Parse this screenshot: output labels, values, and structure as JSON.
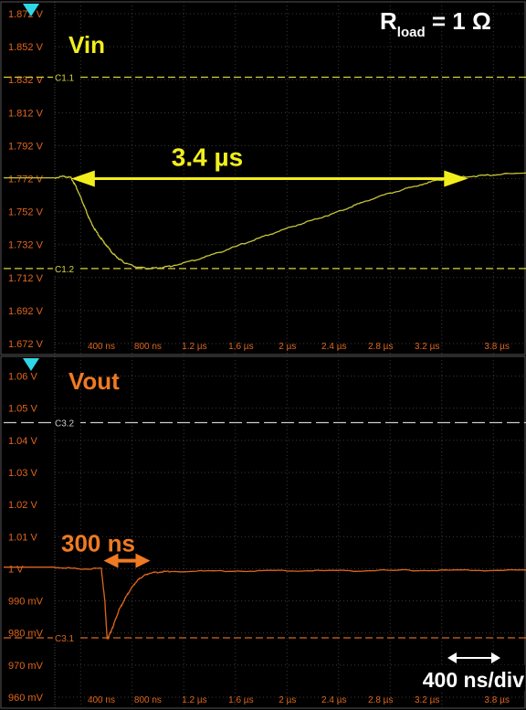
{
  "chart_data": [
    {
      "type": "line",
      "title": "Vin",
      "title_color": "#f2ee1c",
      "trace_color": "#c8c63a",
      "annotation_top_right": {
        "main": "R",
        "sub": "load",
        "rest": " = 1 Ω",
        "color": "#ffffff"
      },
      "ytick_labels": [
        "1.872 V",
        "1.852 V",
        "1.832 V",
        "1.812 V",
        "1.792 V",
        "1.772 V",
        "1.752 V",
        "1.732 V",
        "1.712 V",
        "1.692 V",
        "1.672 V"
      ],
      "ytick_values": [
        1.872,
        1.852,
        1.832,
        1.812,
        1.792,
        1.772,
        1.752,
        1.732,
        1.712,
        1.692,
        1.672
      ],
      "ylim": [
        1.672,
        1.877
      ],
      "xtick_labels": [
        "400 ns",
        "800 ns",
        "1.2 µs",
        "1.6 µs",
        "2 µs",
        "2.4 µs",
        "2.8 µs",
        "3.2 µs",
        "3.8 µs"
      ],
      "xtick_values": [
        0.4,
        0.8,
        1.2,
        1.6,
        2.0,
        2.4,
        2.8,
        3.2,
        3.8
      ],
      "xlim": [
        0,
        4.05
      ],
      "x_unit": "µs",
      "cursors": [
        {
          "label": "C1.1",
          "value": 1.8335,
          "color": "#d8d23a"
        },
        {
          "label": "C1.2",
          "value": 1.7175,
          "color": "#d8d23a"
        }
      ],
      "measurement": {
        "label": "3.4 µs",
        "x_start": 0.14,
        "x_end": 3.55,
        "y": 1.772,
        "color": "#f2ee1c"
      },
      "x": [
        0.0,
        0.08,
        0.14,
        0.18,
        0.22,
        0.26,
        0.3,
        0.35,
        0.4,
        0.45,
        0.5,
        0.55,
        0.6,
        0.7,
        0.8,
        0.9,
        1.0,
        1.2,
        1.4,
        1.6,
        1.8,
        2.0,
        2.2,
        2.4,
        2.6,
        2.8,
        3.0,
        3.2,
        3.4,
        3.6,
        3.8,
        4.05
      ],
      "y": [
        1.7725,
        1.7735,
        1.7725,
        1.7675,
        1.761,
        1.754,
        1.747,
        1.7405,
        1.7355,
        1.731,
        1.7265,
        1.7235,
        1.721,
        1.7185,
        1.7175,
        1.718,
        1.719,
        1.7225,
        1.727,
        1.732,
        1.737,
        1.742,
        1.7465,
        1.751,
        1.7565,
        1.7615,
        1.7655,
        1.7695,
        1.7725,
        1.7735,
        1.7745,
        1.7755
      ]
    },
    {
      "type": "line",
      "title": "Vout",
      "title_color": "#f07a22",
      "trace_color": "#e0661c",
      "ytick_labels": [
        "1.06 V",
        "1.05 V",
        "1.04 V",
        "1.03 V",
        "1.02 V",
        "1.01 V",
        "1 V",
        "990 mV",
        "980 mV",
        "970 mV",
        "960 mV"
      ],
      "ytick_values": [
        1.06,
        1.05,
        1.04,
        1.03,
        1.02,
        1.01,
        1.0,
        0.99,
        0.98,
        0.97,
        0.96
      ],
      "ylim": [
        0.96,
        1.065
      ],
      "xtick_labels": [
        "400 ns",
        "800 ns",
        "1.2 µs",
        "1.6 µs",
        "2 µs",
        "2.4 µs",
        "2.8 µs",
        "3.2 µs",
        "3.8 µs"
      ],
      "xtick_values": [
        0.4,
        0.8,
        1.2,
        1.6,
        2.0,
        2.4,
        2.8,
        3.2,
        3.8
      ],
      "xlim": [
        0,
        4.05
      ],
      "x_unit": "µs",
      "cursors": [
        {
          "label": "C3.2",
          "value": 1.0455,
          "color": "#cccccc"
        },
        {
          "label": "C3.1",
          "value": 0.9785,
          "color": "#d2691e"
        }
      ],
      "measurement": {
        "label": "300 ns",
        "x_start": 0.42,
        "x_end": 0.82,
        "y": 1.0025,
        "color": "#f07a22"
      },
      "timebase_label": "400 ns/div",
      "timebase_color": "#ffffff",
      "x": [
        0.0,
        0.2,
        0.4,
        0.43,
        0.45,
        0.47,
        0.49,
        0.51,
        0.55,
        0.6,
        0.65,
        0.7,
        0.75,
        0.8,
        0.9,
        1.0,
        1.5,
        2.0,
        2.5,
        3.0,
        3.5,
        4.05
      ],
      "y": [
        1.0005,
        1.0,
        1.0,
        0.99,
        0.978,
        0.9795,
        0.981,
        0.983,
        0.987,
        0.9905,
        0.9935,
        0.996,
        0.9975,
        0.9985,
        0.999,
        0.9992,
        0.9993,
        0.9994,
        0.9994,
        0.9995,
        0.9995,
        0.9996
      ]
    }
  ]
}
